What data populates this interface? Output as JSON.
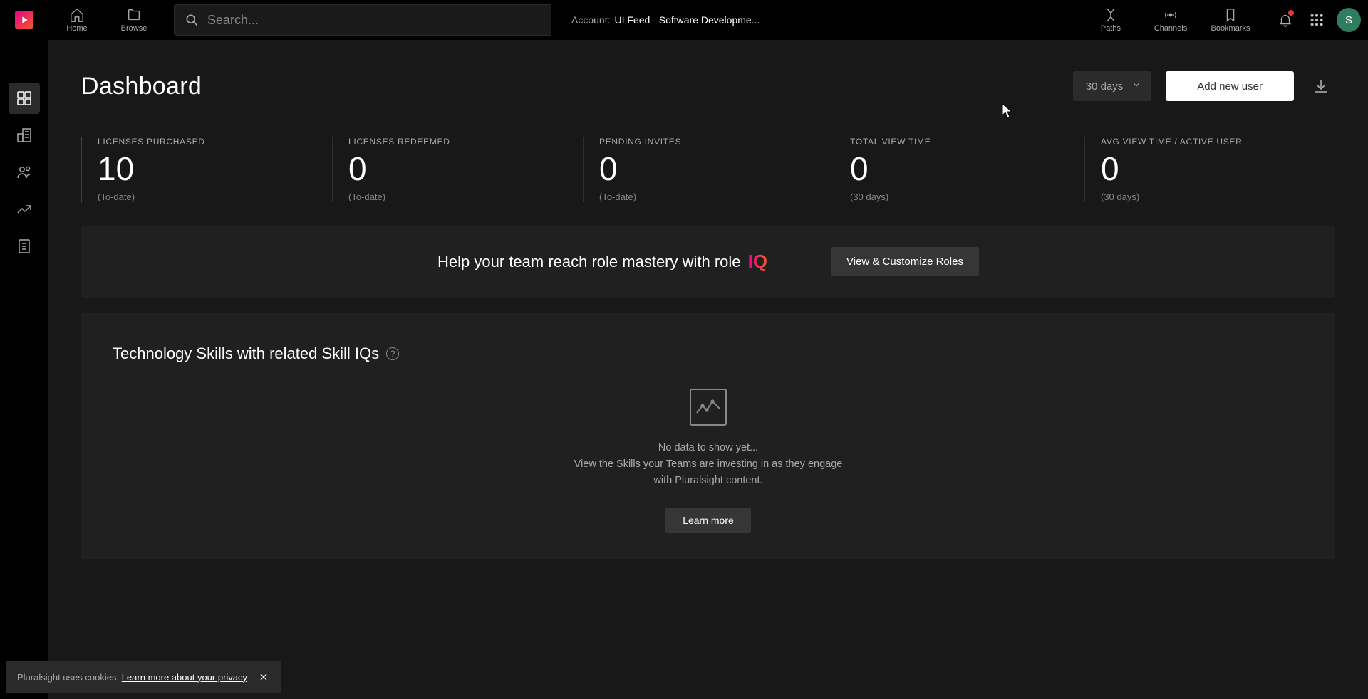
{
  "brand": {
    "name": "Pluralsight"
  },
  "top_nav": {
    "home": "Home",
    "browse": "Browse",
    "paths": "Paths",
    "channels": "Channels",
    "bookmarks": "Bookmarks"
  },
  "search": {
    "placeholder": "Search..."
  },
  "account": {
    "label": "Account:",
    "value": "UI Feed - Software Developme..."
  },
  "avatar": {
    "initial": "S"
  },
  "dashboard": {
    "title": "Dashboard",
    "range_selected": "30 days",
    "add_user": "Add new user"
  },
  "stats": [
    {
      "label": "LICENSES PURCHASED",
      "value": "10",
      "sub": "(To-date)"
    },
    {
      "label": "LICENSES REDEEMED",
      "value": "0",
      "sub": "(To-date)"
    },
    {
      "label": "PENDING INVITES",
      "value": "0",
      "sub": "(To-date)"
    },
    {
      "label": "TOTAL VIEW TIME",
      "value": "0",
      "sub": "(30 days)"
    },
    {
      "label": "AVG VIEW TIME / ACTIVE USER",
      "value": "0",
      "sub": "(30 days)"
    }
  ],
  "roleiq": {
    "text": "Help your team reach role mastery with role",
    "badge": "IQ",
    "cta": "View & Customize Roles"
  },
  "skills_section": {
    "title": "Technology Skills with related Skill IQs",
    "empty_line1": "No data to show yet...",
    "empty_line2": "View the Skills your Teams are investing in as they engage with Pluralsight content.",
    "learn_more": "Learn more"
  },
  "cookie": {
    "text": "Pluralsight uses cookies.",
    "link": "Learn more about your privacy"
  },
  "colors": {
    "accent_start": "#EC008C",
    "accent_end": "#F15A24",
    "notif_dot": "#e53935"
  }
}
